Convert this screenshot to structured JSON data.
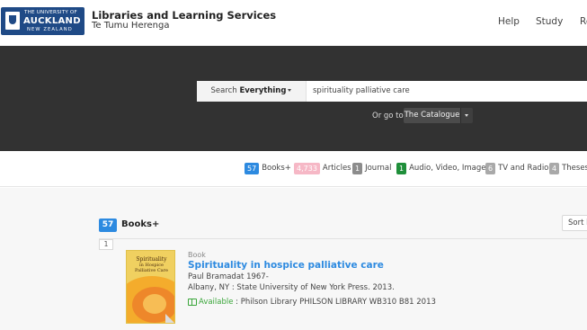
{
  "header": {
    "logo": {
      "line1": "THE UNIVERSITY OF",
      "line2": "AUCKLAND",
      "line3": "NEW ZEALAND"
    },
    "title": "Libraries and Learning Services",
    "subtitle": "Te Tumu Herenga",
    "nav": [
      "Help",
      "Study",
      "Re"
    ]
  },
  "search": {
    "scope_prefix": "Search",
    "scope_value": "Everything",
    "query": "spirituality palliative care",
    "goto_label": "Or go to",
    "goto_value": "The Catalogue"
  },
  "facets": [
    {
      "count": "57",
      "label": "Books+",
      "color": "#2d8ae0"
    },
    {
      "count": "4,733",
      "label": "Articles",
      "color": "#f6b8c6"
    },
    {
      "count": "1",
      "label": "Journal",
      "color": "#8c8c8c"
    },
    {
      "count": "1",
      "label": "Audio, Video, Images",
      "color": "#1f8f3a"
    },
    {
      "count": "6",
      "label": "TV and Radio",
      "color": "#a9a9a9"
    },
    {
      "count": "4",
      "label": "Theses",
      "color": "#a9a9a9"
    }
  ],
  "results": {
    "count": "57",
    "label": "Books+",
    "sort_label": "Sort b",
    "page": "1",
    "items": [
      {
        "type": "Book",
        "title": "Spirituality in hospice palliative care",
        "author": "Paul Bramadat 1967-",
        "publication": "Albany, NY : State University of New York Press. 2013.",
        "availability_status": "Available",
        "availability_detail": " : Philson Library PHILSON LIBRARY WB310 B81 2013",
        "cover": {
          "title_line1": "Spirituality",
          "title_line2": "in Hospice",
          "title_line3": "Palliative Care"
        }
      }
    ]
  }
}
